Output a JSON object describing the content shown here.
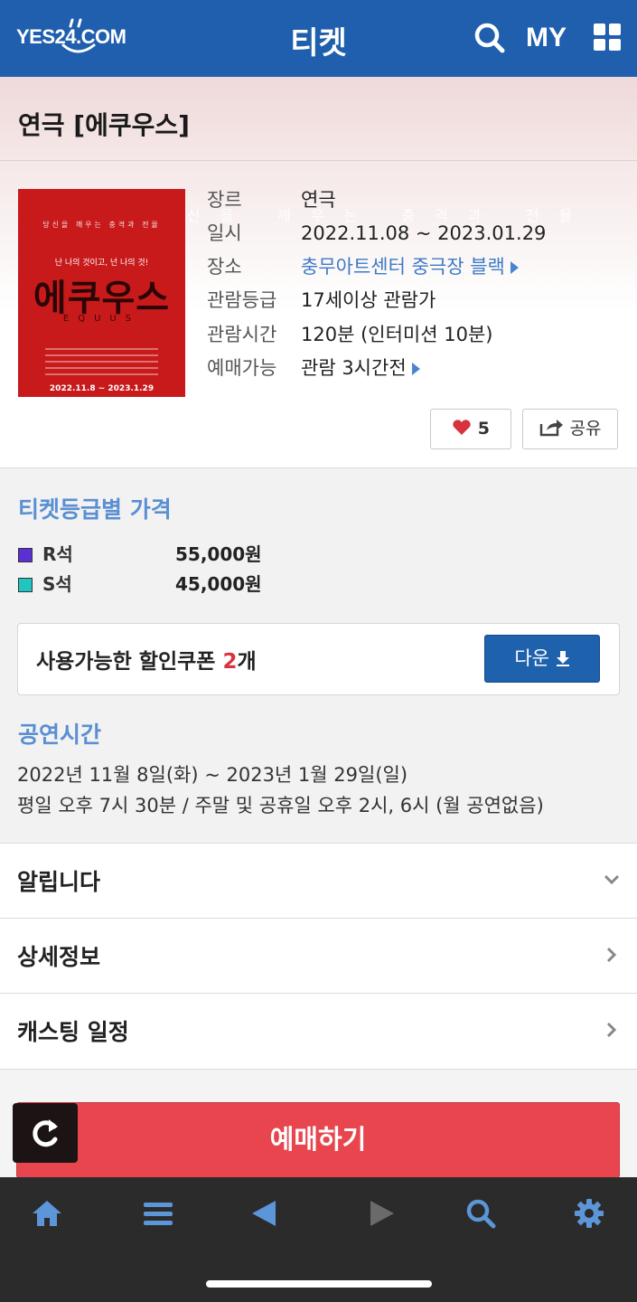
{
  "header": {
    "logo_text": "YES24.COM",
    "title": "티켓",
    "my_label": "MY",
    "bg_color": "#1f5fae"
  },
  "show": {
    "title": "연극 [에쿠우스]",
    "poster": {
      "tagline": "당신을 깨우는 충격과 전율",
      "subtitle": "난 나의 것이고, 넌 나의 것!",
      "big_title": "에쿠우스",
      "latin": "EQUUS",
      "date": "2022.11.8 ~ 2023.1.29"
    },
    "info": [
      {
        "key": "장르",
        "value": "연극",
        "link": false
      },
      {
        "key": "일시",
        "value": "2022.11.08 ~ 2023.01.29",
        "link": false
      },
      {
        "key": "장소",
        "value": "충무아트센터 중극장 블랙",
        "link": true
      },
      {
        "key": "관람등급",
        "value": "17세이상 관람가",
        "link": false
      },
      {
        "key": "관람시간",
        "value": "120분 (인터미션 10분)",
        "link": false
      },
      {
        "key": "예매가능",
        "value": "관람 3시간전",
        "link": true
      }
    ],
    "like_count": "5",
    "share_label": "공유"
  },
  "prices": {
    "title": "티켓등급별 가격",
    "items": [
      {
        "name": "R석",
        "price": "55,000원",
        "color": "#5b2fd6"
      },
      {
        "name": "S석",
        "price": "45,000원",
        "color": "#20c5c0"
      }
    ]
  },
  "coupon": {
    "text_prefix": "사용가능한 할인쿠폰 ",
    "count": "2",
    "text_suffix": "개",
    "button_label": "다운"
  },
  "schedule": {
    "title": "공연시간",
    "line1": "2022년 11월 8일(화) ~ 2023년 1월 29일(일)",
    "line2": "평일 오후 7시 30분 / 주말 및 공휴일 오후 2시, 6시 (월 공연없음)"
  },
  "menu": [
    {
      "label": "알립니다",
      "arrow": "chevron-down-icon"
    },
    {
      "label": "상세정보",
      "arrow": "chevron-right-icon"
    },
    {
      "label": "캐스팅 일정",
      "arrow": "chevron-right-icon"
    }
  ],
  "book_label": "예매하기"
}
